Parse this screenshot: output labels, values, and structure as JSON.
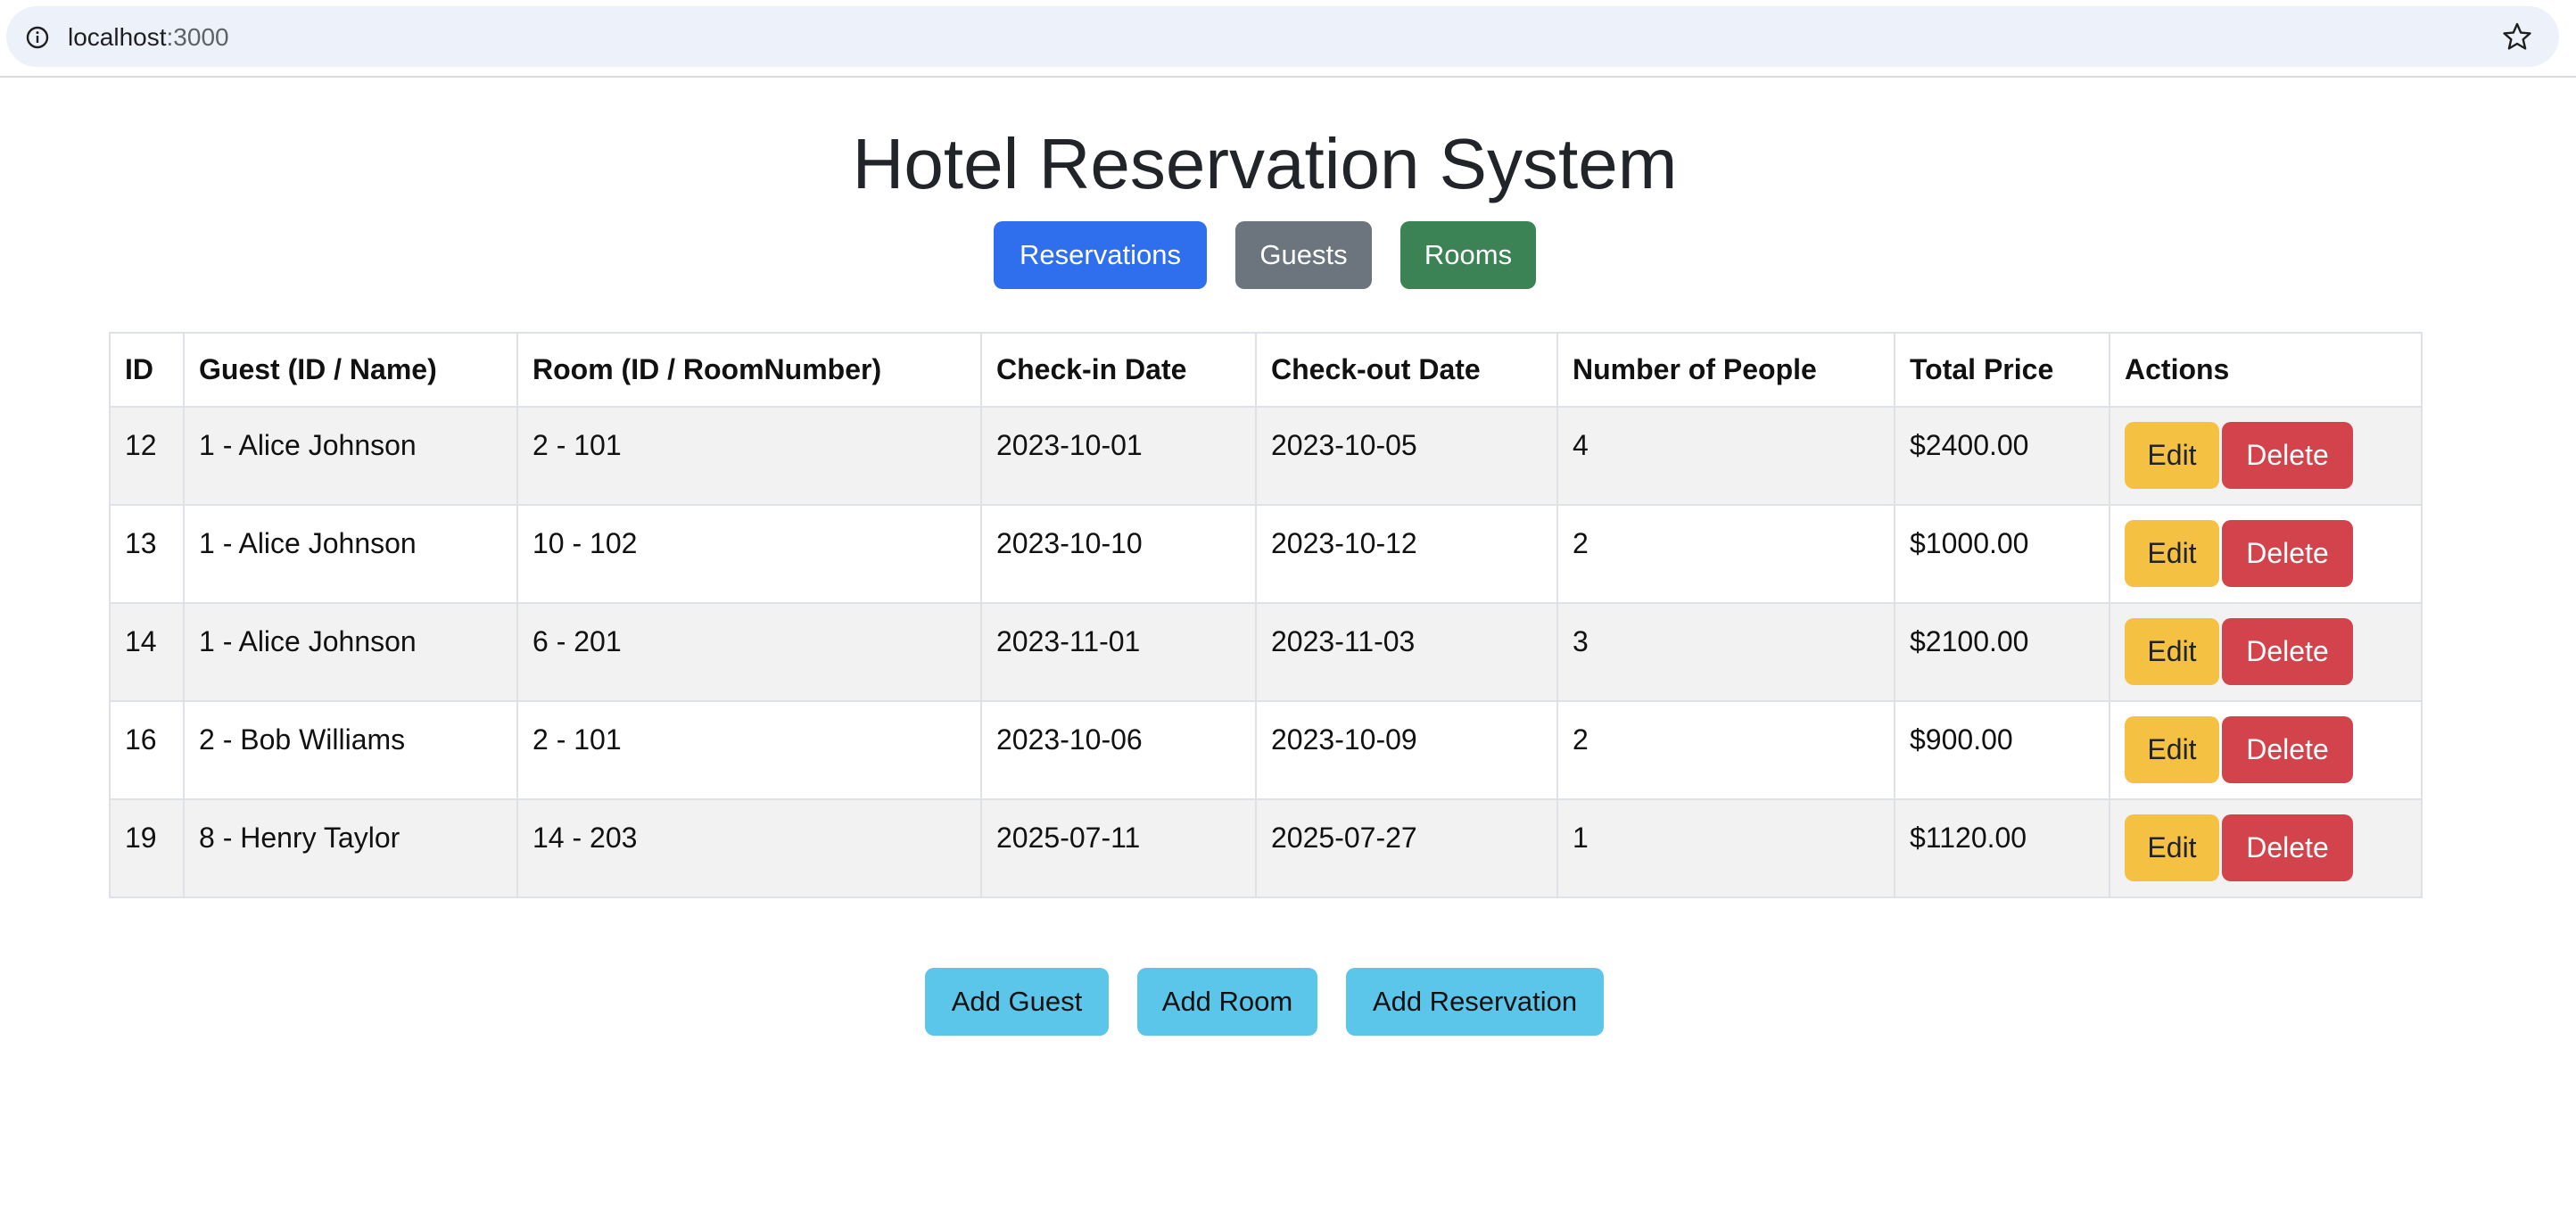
{
  "browser": {
    "url_host": "localhost",
    "url_port": ":3000",
    "info_icon": "info-icon",
    "bookmark_icon": "star-icon"
  },
  "page": {
    "title": "Hotel Reservation System"
  },
  "nav": {
    "reservations_label": "Reservations",
    "guests_label": "Guests",
    "rooms_label": "Rooms"
  },
  "table": {
    "headers": [
      "ID",
      "Guest (ID / Name)",
      "Room (ID / RoomNumber)",
      "Check-in Date",
      "Check-out Date",
      "Number of People",
      "Total Price",
      "Actions"
    ],
    "rows": [
      {
        "id": "12",
        "guest": "1 - Alice Johnson",
        "room": "2 - 101",
        "checkin": "2023-10-01",
        "checkout": "2023-10-05",
        "people": "4",
        "price": "$2400.00"
      },
      {
        "id": "13",
        "guest": "1 - Alice Johnson",
        "room": "10 - 102",
        "checkin": "2023-10-10",
        "checkout": "2023-10-12",
        "people": "2",
        "price": "$1000.00"
      },
      {
        "id": "14",
        "guest": "1 - Alice Johnson",
        "room": "6 - 201",
        "checkin": "2023-11-01",
        "checkout": "2023-11-03",
        "people": "3",
        "price": "$2100.00"
      },
      {
        "id": "16",
        "guest": "2 - Bob Williams",
        "room": "2 - 101",
        "checkin": "2023-10-06",
        "checkout": "2023-10-09",
        "people": "2",
        "price": "$900.00"
      },
      {
        "id": "19",
        "guest": "8 - Henry Taylor",
        "room": "14 - 203",
        "checkin": "2025-07-11",
        "checkout": "2025-07-27",
        "people": "1",
        "price": "$1120.00"
      }
    ],
    "edit_label": "Edit",
    "delete_label": "Delete"
  },
  "footer_actions": {
    "add_guest_label": "Add Guest",
    "add_room_label": "Add Room",
    "add_reservation_label": "Add Reservation"
  },
  "colors": {
    "primary": "#2f6fed",
    "secondary": "#6c757d",
    "success": "#3b8354",
    "warning": "#f4c142",
    "danger": "#d2434b",
    "info": "#5bc6ea"
  }
}
